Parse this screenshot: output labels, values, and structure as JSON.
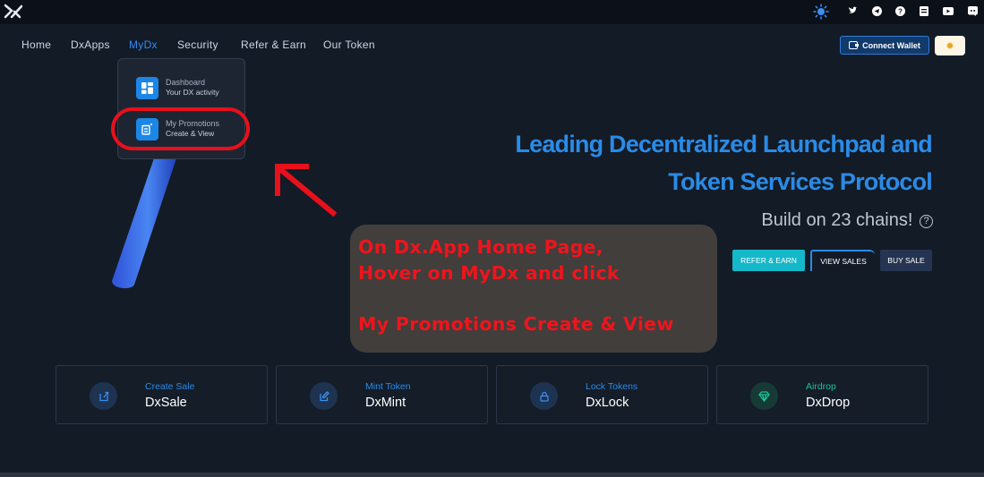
{
  "nav": {
    "items": [
      "Home",
      "DxApps",
      "MyDx",
      "Security",
      "Refer & Earn",
      "Our Token"
    ],
    "active": "MyDx"
  },
  "header": {
    "connect_wallet": "Connect Wallet",
    "social_icons": [
      "twitter-icon",
      "telegram-icon",
      "help-icon",
      "docs-icon",
      "youtube-icon",
      "discord-icon"
    ],
    "theme_icon": "sun-icon"
  },
  "dropdown": {
    "items": [
      {
        "title": "Dashboard",
        "subtitle": "Your DX activity",
        "icon": "dashboard-icon"
      },
      {
        "title": "My Promotions",
        "subtitle": "Create & View",
        "icon": "promotions-icon"
      }
    ]
  },
  "hero": {
    "title_line1": "Leading Decentralized Launchpad and",
    "title_line2": "Token Services Protocol",
    "chains": "Build on 23 chains!",
    "buttons": {
      "refer": "REFER & EARN",
      "view": "VIEW SALES",
      "buy": "BUY SALE"
    }
  },
  "annotation": {
    "line1": "On Dx.App Home Page,",
    "line2": "Hover on MyDx and click",
    "line3": "My Promotions Create & View"
  },
  "cards": [
    {
      "label": "Create Sale",
      "name": "DxSale",
      "icon": "create-sale-icon",
      "accent": "#2a8be6"
    },
    {
      "label": "Mint Token",
      "name": "DxMint",
      "icon": "mint-icon",
      "accent": "#2a8be6"
    },
    {
      "label": "Lock Tokens",
      "name": "DxLock",
      "icon": "lock-icon",
      "accent": "#2a8be6"
    },
    {
      "label": "Airdrop",
      "name": "DxDrop",
      "icon": "airdrop-icon",
      "accent": "#19c39a"
    }
  ],
  "colors": {
    "accent": "#2a8be6",
    "annotation": "#f0141c",
    "teal": "#14b8c8"
  }
}
